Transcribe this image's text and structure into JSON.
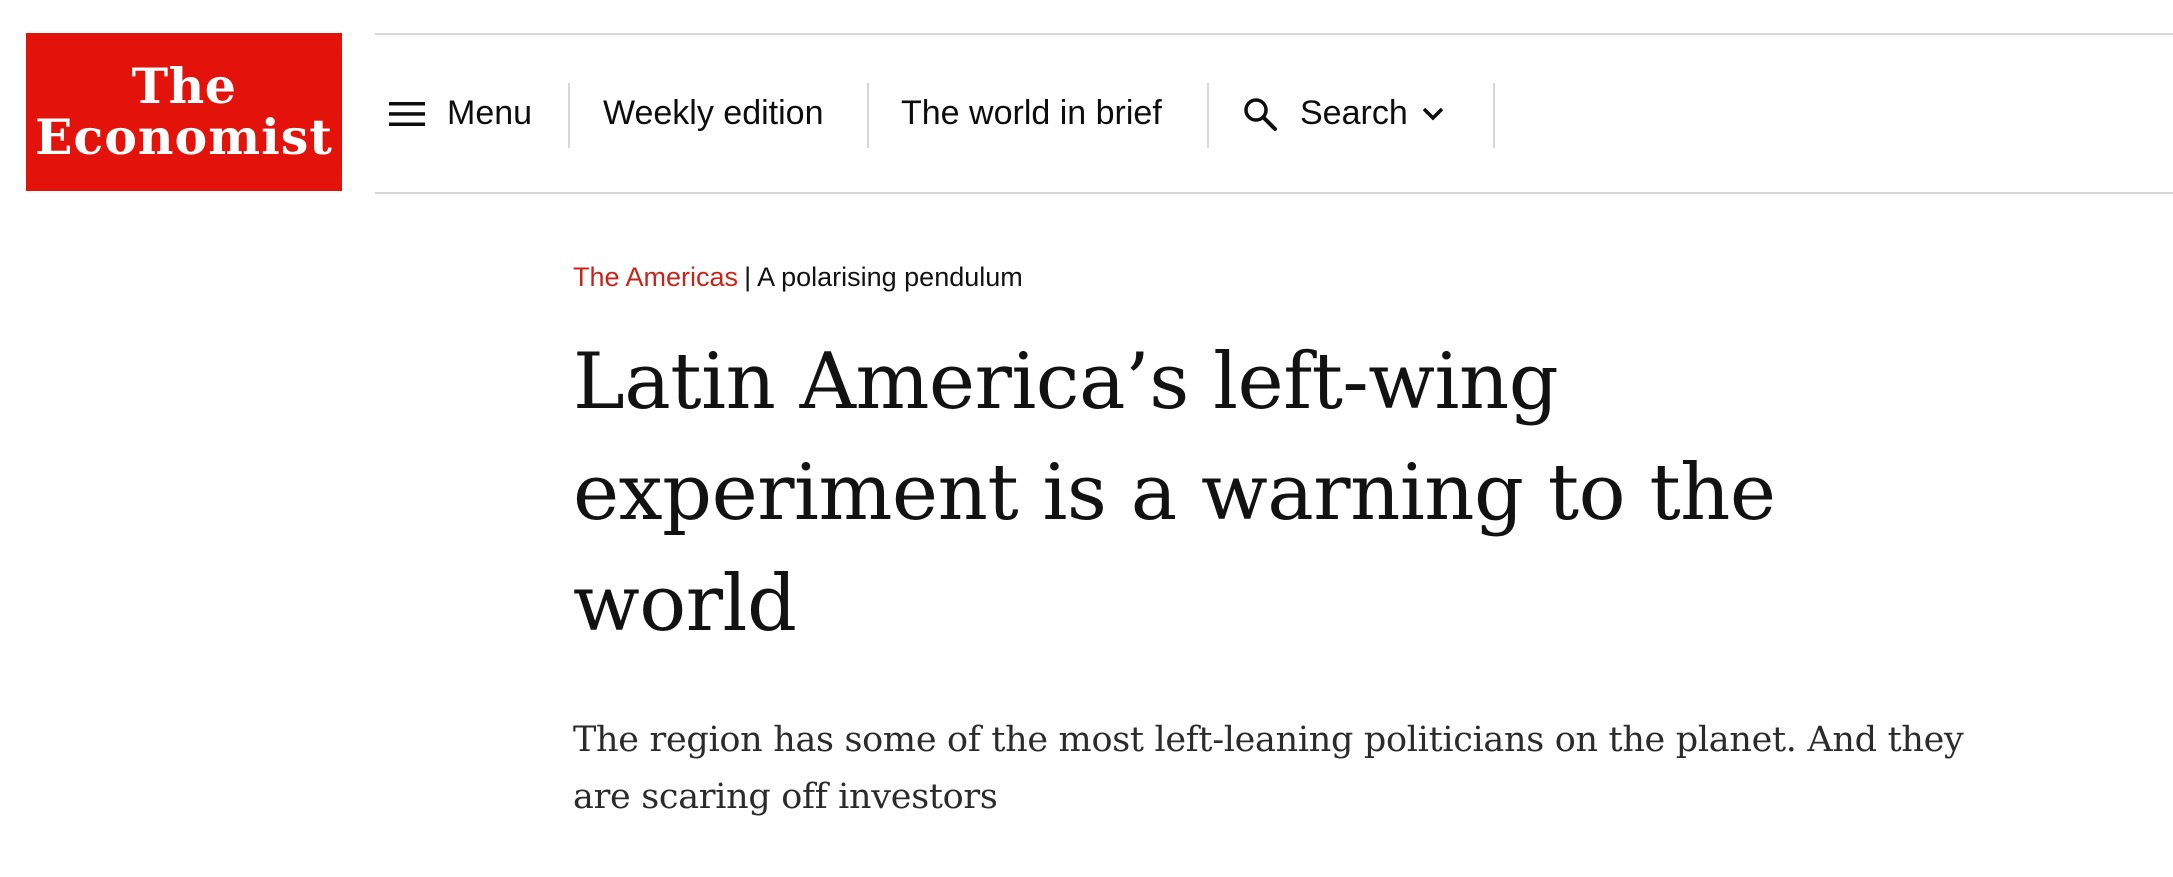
{
  "logo": {
    "line1": "The",
    "line2": "Economist",
    "color": "#e3120b"
  },
  "nav": {
    "menu_label": "Menu",
    "weekly_label": "Weekly edition",
    "brief_label": "The world in brief",
    "search_label": "Search",
    "icons": {
      "menu": "hamburger-icon",
      "search": "search-icon",
      "dropdown": "chevron-down-icon"
    }
  },
  "article": {
    "section": "The Americas",
    "separator": "|",
    "rubric": "A polarising pendulum",
    "headline": "Latin America’s left-wing experiment is a warning to the world",
    "standfirst": "The region has some of the most left-leaning politicians on the planet. And they are scaring off investors",
    "section_color": "#c8251a"
  }
}
